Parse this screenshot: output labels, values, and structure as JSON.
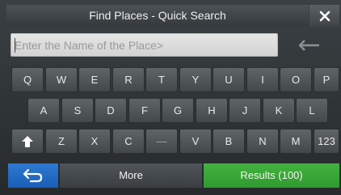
{
  "title": "Find Places - Quick Search",
  "search": {
    "placeholder": "Enter the Name of the Place>",
    "value": ""
  },
  "keyboard": {
    "row1": [
      "Q",
      "W",
      "E",
      "R",
      "T",
      "Y",
      "U",
      "I",
      "O",
      "P"
    ],
    "row2": [
      "A",
      "S",
      "D",
      "F",
      "G",
      "H",
      "J",
      "K",
      "L"
    ],
    "row3_letters": [
      "Z",
      "X",
      "C",
      "V",
      "B",
      "N",
      "M"
    ],
    "space_label": "—",
    "numbers_label": "123"
  },
  "bottom": {
    "more_label": "More",
    "results_label": "Results (100)"
  },
  "colors": {
    "accent_blue": "#2f79d3",
    "accent_green": "#3aa838",
    "key_bg": "#505558"
  }
}
